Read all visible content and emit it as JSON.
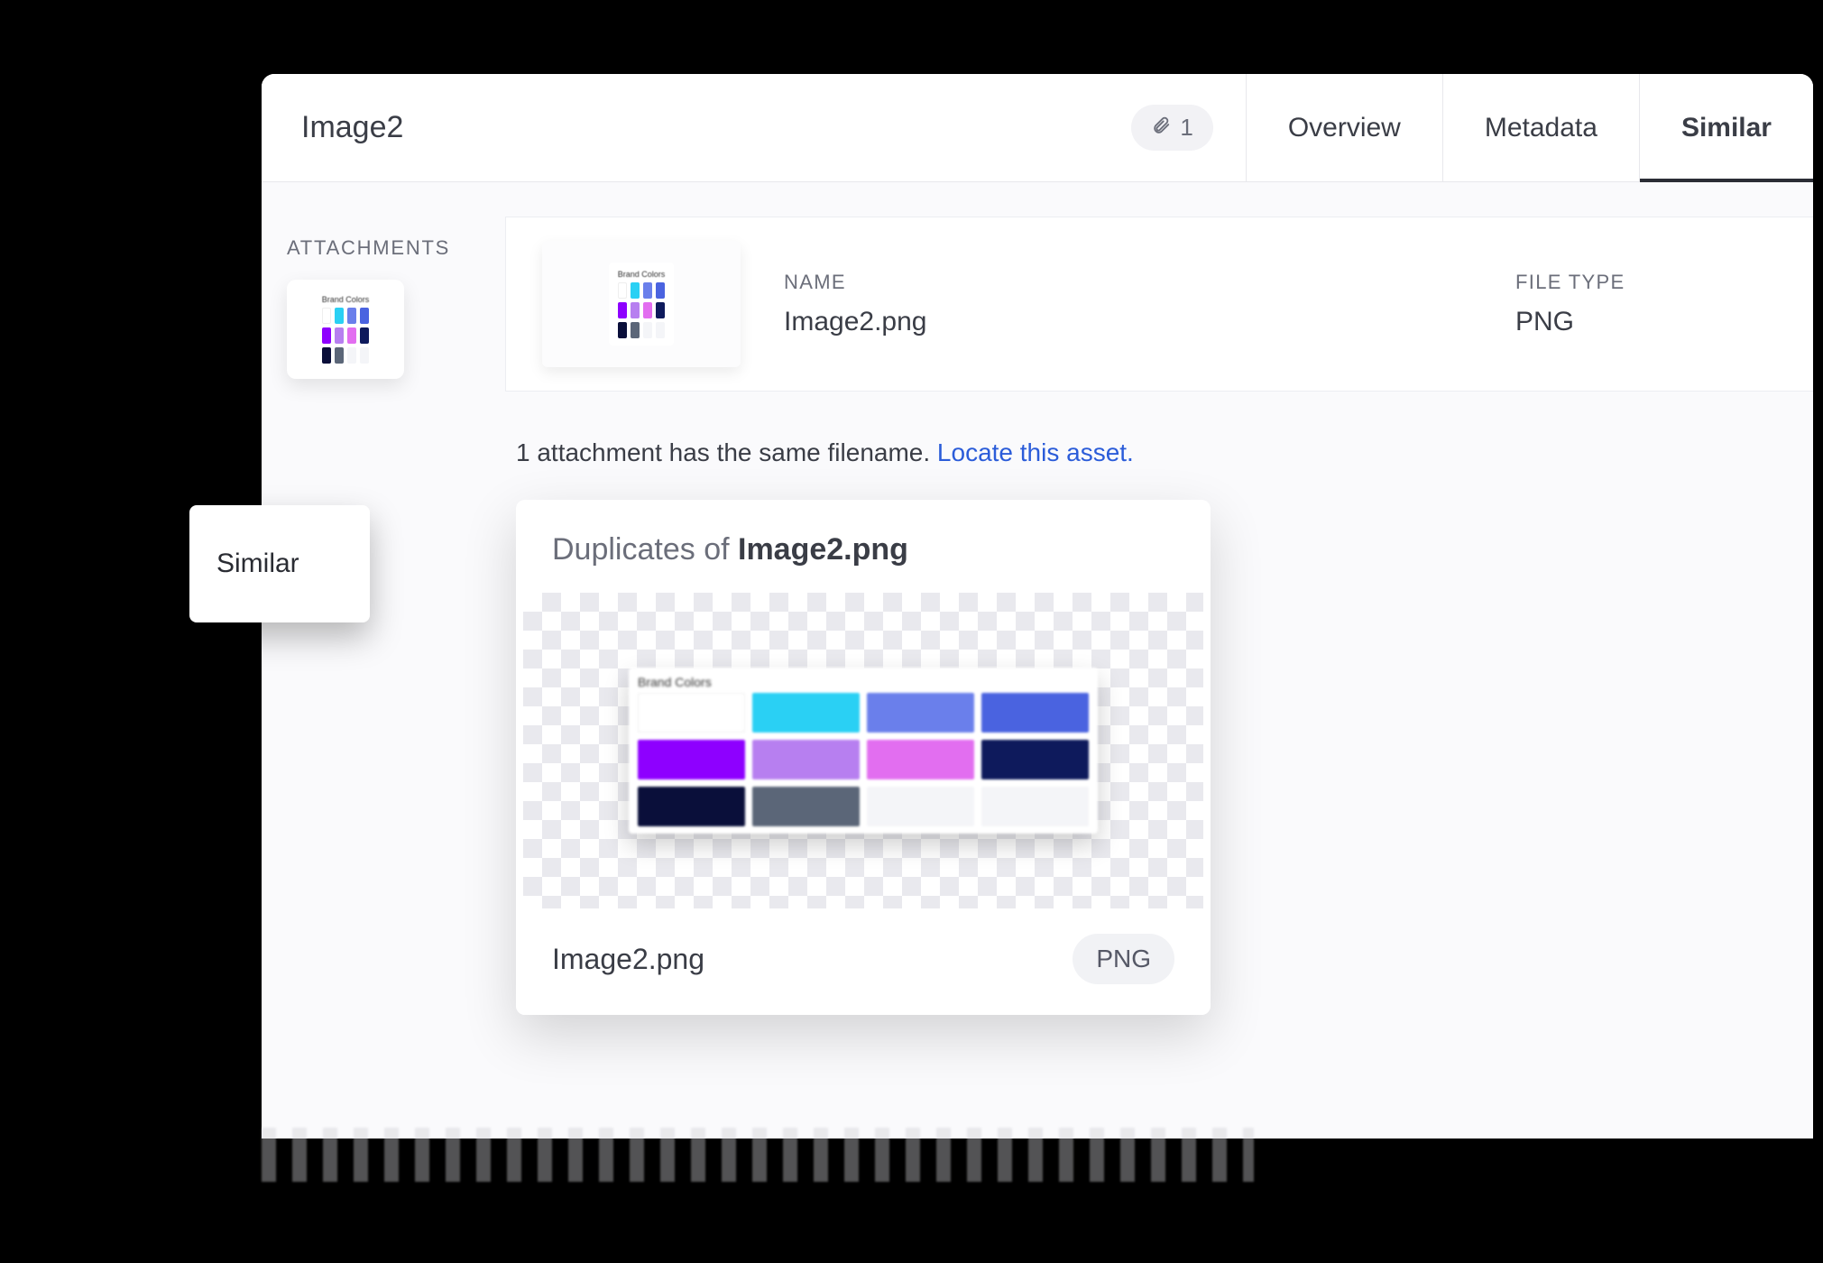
{
  "header": {
    "title": "Image2",
    "attachment_count": "1",
    "tabs": [
      "Overview",
      "Metadata",
      "Similar"
    ],
    "active_tab": "Similar"
  },
  "sidebar": {
    "label": "ATTACHMENTS"
  },
  "row": {
    "name_label": "NAME",
    "name_value": "Image2.png",
    "type_label": "FILE TYPE",
    "type_value": "PNG"
  },
  "message": {
    "text": "1 attachment has the same filename. ",
    "link": "Locate this asset."
  },
  "dup": {
    "title_prefix": "Duplicates of ",
    "title_name": "Image2.png",
    "file_name": "Image2.png",
    "badge": "PNG"
  },
  "palette_label": "Brand Colors",
  "floating_label": "Similar"
}
